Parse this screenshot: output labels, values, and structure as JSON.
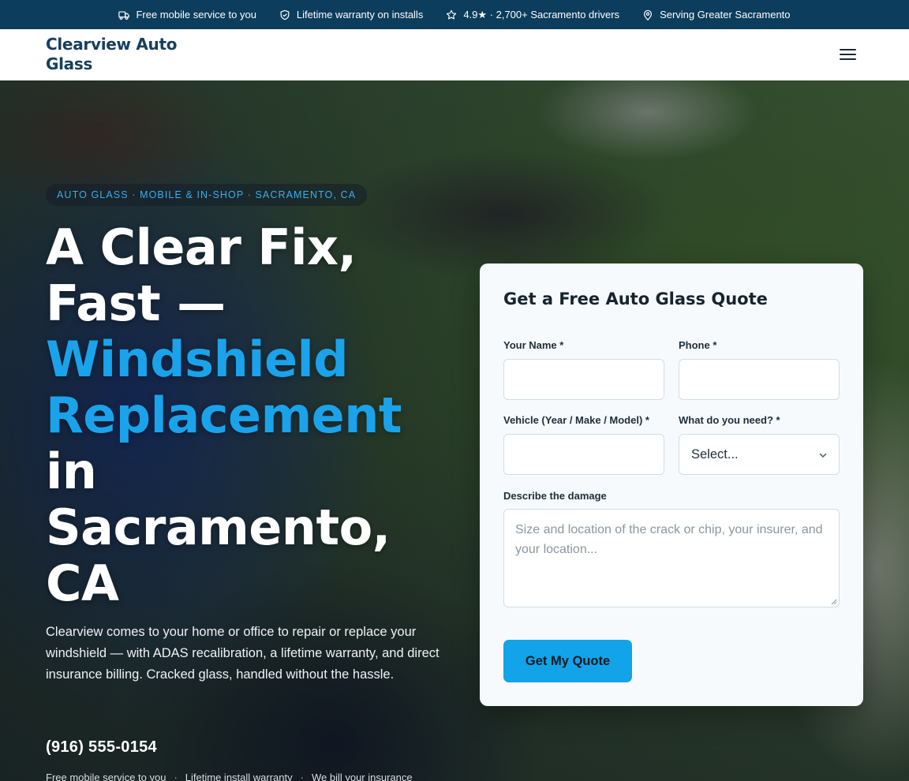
{
  "topbar": {
    "items": [
      {
        "icon": "truck-icon",
        "label": "Free mobile service to you"
      },
      {
        "icon": "shield-check-icon",
        "label": "Lifetime warranty on installs"
      },
      {
        "icon": "star-icon",
        "label": "4.9★ · 2,700+ Sacramento drivers"
      },
      {
        "icon": "map-pin-icon",
        "label": "Serving Greater Sacramento"
      }
    ]
  },
  "header": {
    "logo": "Clearview Auto Glass",
    "menu_icon": "hamburger-menu-icon"
  },
  "hero": {
    "eyebrow": "AUTO GLASS · MOBILE & IN-SHOP · SACRAMENTO, CA",
    "headline_1": "A Clear Fix, Fast —",
    "headline_accent": "Windshield Replacement",
    "headline_2": "in Sacramento, CA",
    "lead": "Clearview comes to your home or office to repair or replace your windshield — with ADAS recalibration, a lifetime warranty, and direct insurance billing. Cracked glass, handled without the hassle.",
    "phone": "(916) 555-0154",
    "benefits": [
      "Free mobile service to you",
      "Lifetime install warranty",
      "We bill your insurance"
    ],
    "separator": "·"
  },
  "quote_form": {
    "title": "Get a Free Auto Glass Quote",
    "name_label": "Your Name *",
    "name_value": "",
    "phone_label": "Phone *",
    "phone_value": "",
    "vehicle_label": "Vehicle (Year / Make / Model) *",
    "vehicle_value": "",
    "need_label": "What do you need? *",
    "need_selected": "Select...",
    "damage_label": "Describe the damage",
    "damage_placeholder": "Size and location of the crack or chip, your insurer, and your location...",
    "submit_label": "Get My Quote"
  },
  "colors": {
    "topbar_bg": "#0c3d5c",
    "logo": "#16405e",
    "accent": "#1aa3ea",
    "button": "#13a3e8"
  }
}
